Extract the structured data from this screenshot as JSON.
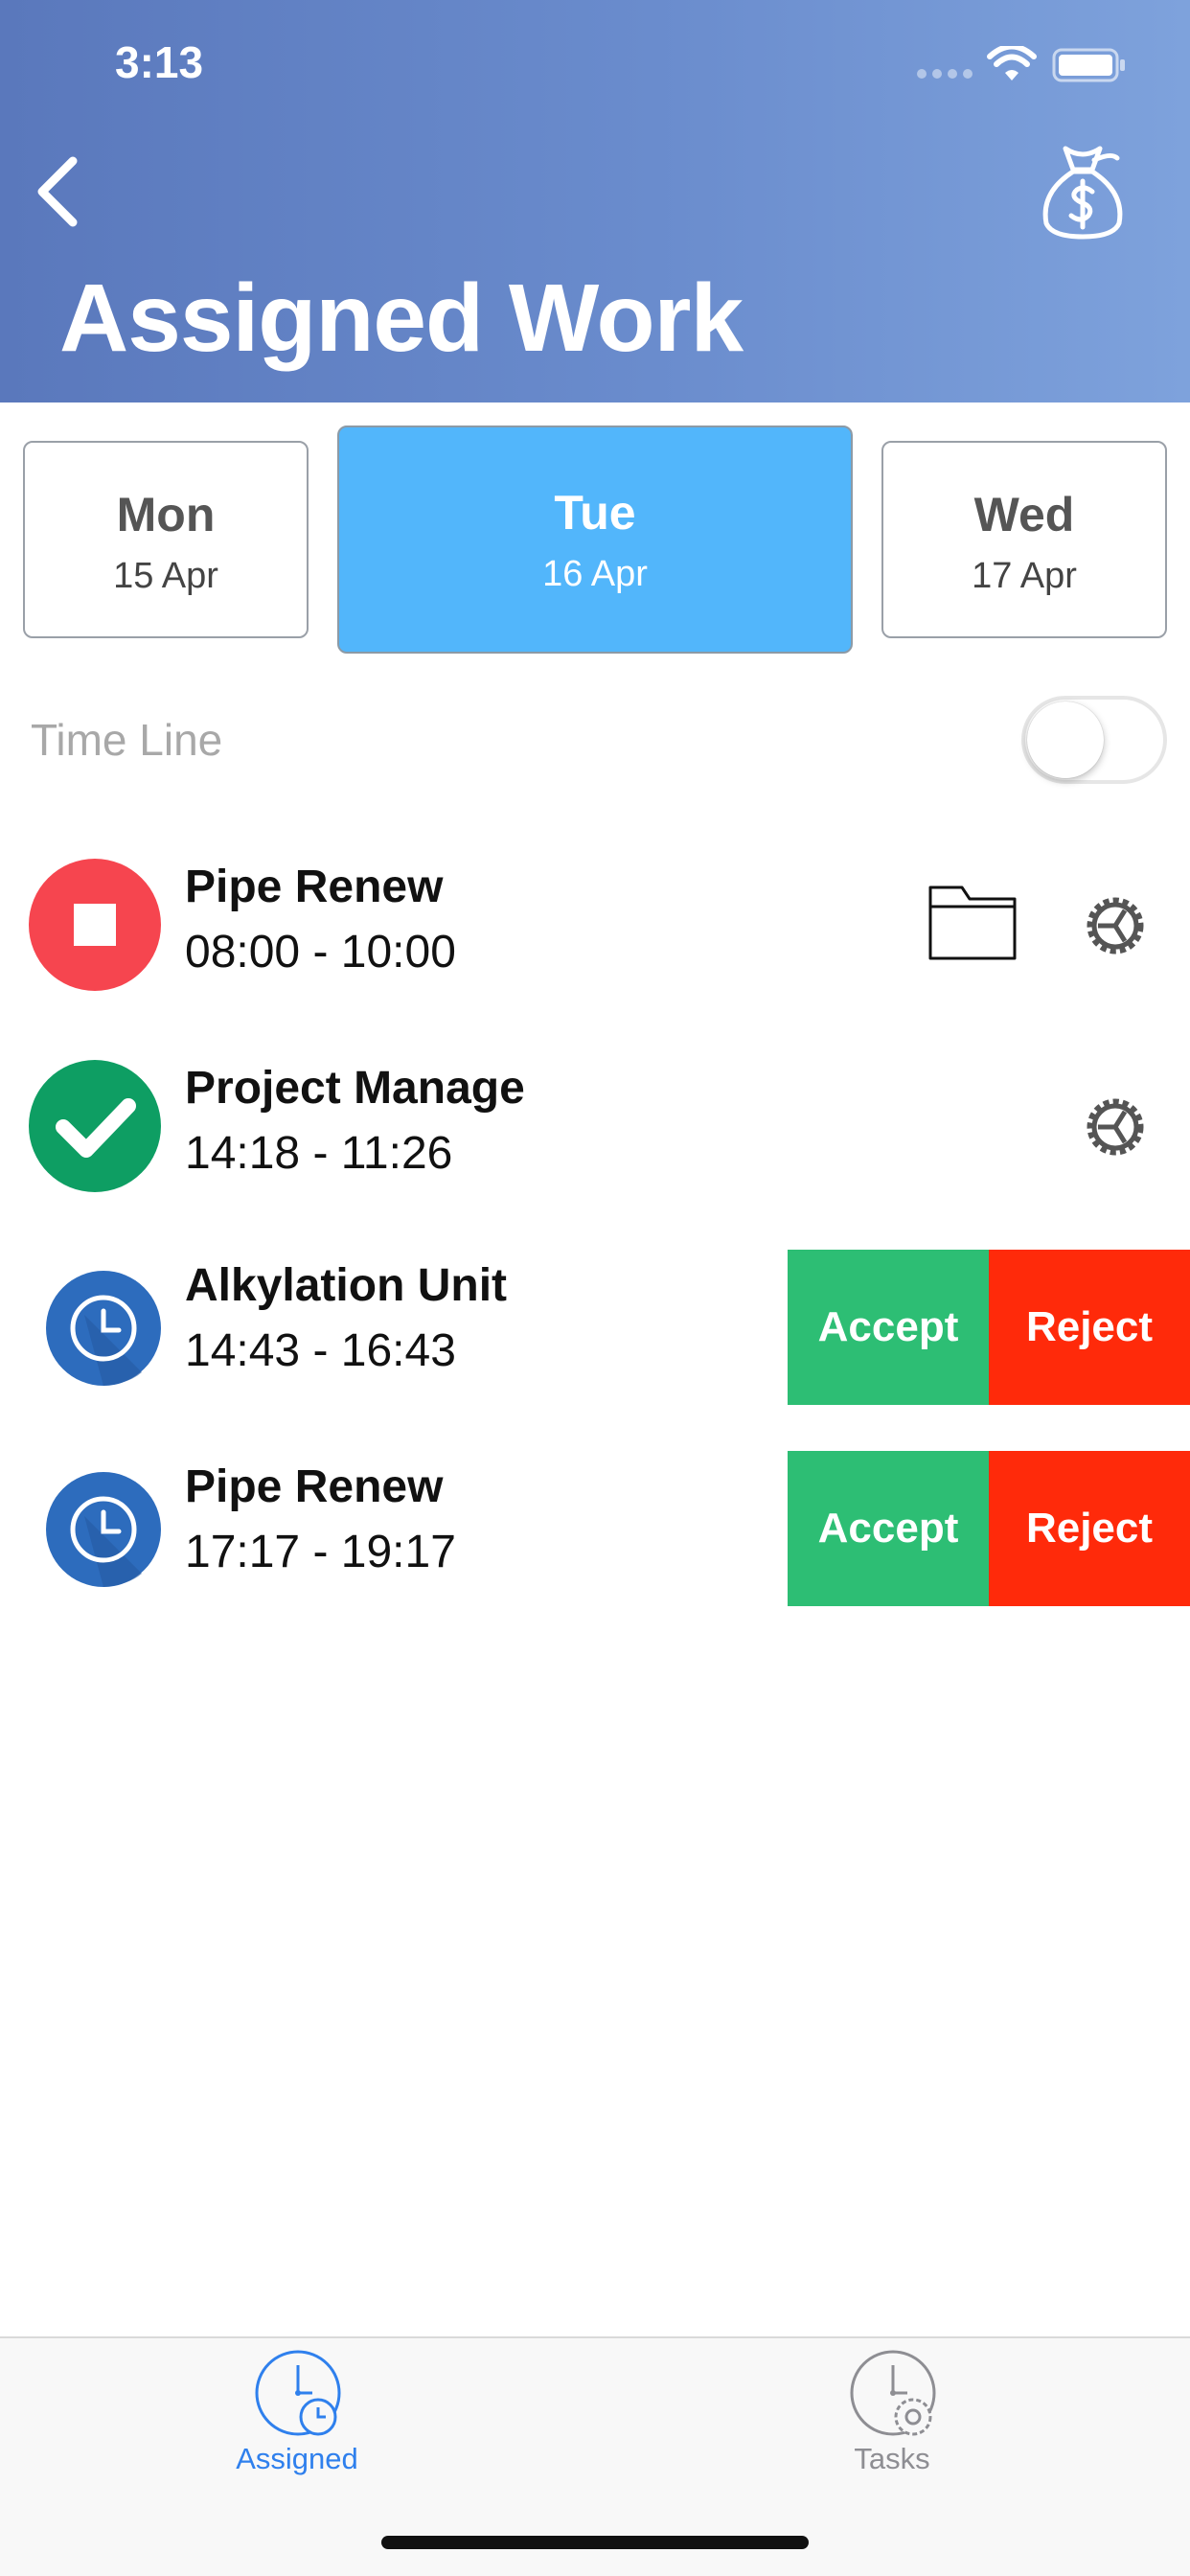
{
  "status_bar": {
    "time": "3:13"
  },
  "header": {
    "title": "Assigned Work",
    "back_icon": "chevron-left-icon",
    "action_icon": "money-bag-icon"
  },
  "days": [
    {
      "name": "Mon",
      "date": "15 Apr",
      "selected": false
    },
    {
      "name": "Tue",
      "date": "16 Apr",
      "selected": true
    },
    {
      "name": "Wed",
      "date": "17 Apr",
      "selected": false
    }
  ],
  "timeline": {
    "label": "Time Line",
    "enabled": false
  },
  "tasks": [
    {
      "title": "Pipe Renew",
      "time": "08:00 - 10:00",
      "status": "in-progress-stop",
      "status_color": "#f6454f",
      "actions": [
        "folder",
        "settings"
      ]
    },
    {
      "title": "Project Manage",
      "time": "14:18 - 11:26",
      "status": "completed",
      "status_color": "#0e9e63",
      "actions": [
        "settings"
      ]
    },
    {
      "title": "Alkylation Unit",
      "time": "14:43 - 16:43",
      "status": "pending",
      "status_color": "#2d6cbd",
      "accept_label": "Accept",
      "reject_label": "Reject"
    },
    {
      "title": "Pipe Renew",
      "time": "17:17 - 19:17",
      "status": "pending",
      "status_color": "#2d6cbd",
      "accept_label": "Accept",
      "reject_label": "Reject"
    }
  ],
  "tab_bar": {
    "items": [
      {
        "label": "Assigned",
        "icon": "clock-assigned-icon",
        "active": true
      },
      {
        "label": "Tasks",
        "icon": "clock-settings-icon",
        "active": false
      }
    ],
    "active_color": "#2f80ed",
    "inactive_color": "#8e8e93"
  }
}
